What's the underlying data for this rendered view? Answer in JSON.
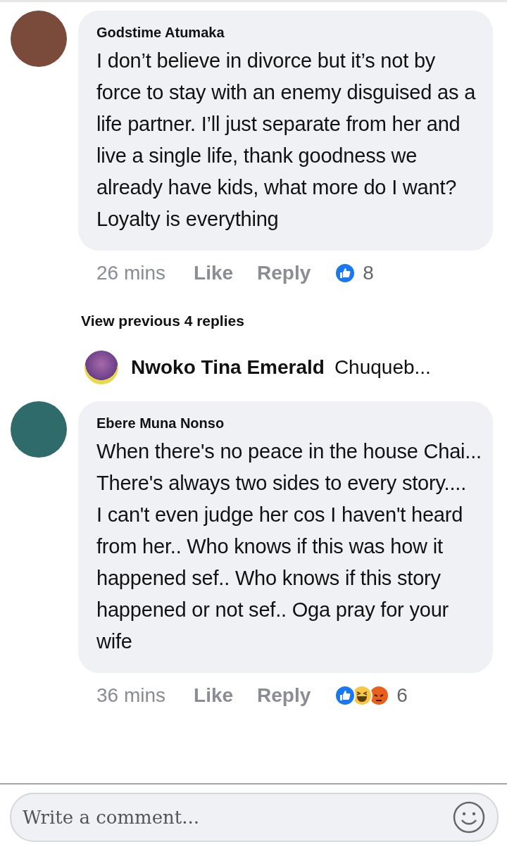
{
  "comments": [
    {
      "author": "Godstime Atumaka",
      "paragraphs": [
        "I don’t believe in divorce but it’s not by force to stay with an enemy disguised as a life partner. I’ll just separate from her and live a single life, thank goodness we already have kids, what more do I want? Loyalty is everything"
      ],
      "time": "26 mins",
      "like": "Like",
      "reply": "Reply",
      "reactions": [
        {
          "kind": "like"
        }
      ],
      "count": "8"
    },
    {
      "author": "Ebere Muna Nonso",
      "paragraphs": [
        "When there's no peace in the house Chai... There's always two sides to every story....",
        "I can't even judge her cos I haven't heard from her.. Who knows if this was how it happened sef.. Who knows if this story happened or not sef.. Oga pray for your wife"
      ],
      "time": "36 mins",
      "like": "Like",
      "reply": "Reply",
      "reactions": [
        {
          "kind": "like"
        },
        {
          "kind": "haha"
        },
        {
          "kind": "angry"
        }
      ],
      "count": "6"
    }
  ],
  "thread": {
    "view_previous": "View previous 4 replies",
    "reply_author": "Nwoko Tina Emerald",
    "reply_preview": "Chuqueb..."
  },
  "composer": {
    "placeholder": "Write a comment..."
  }
}
